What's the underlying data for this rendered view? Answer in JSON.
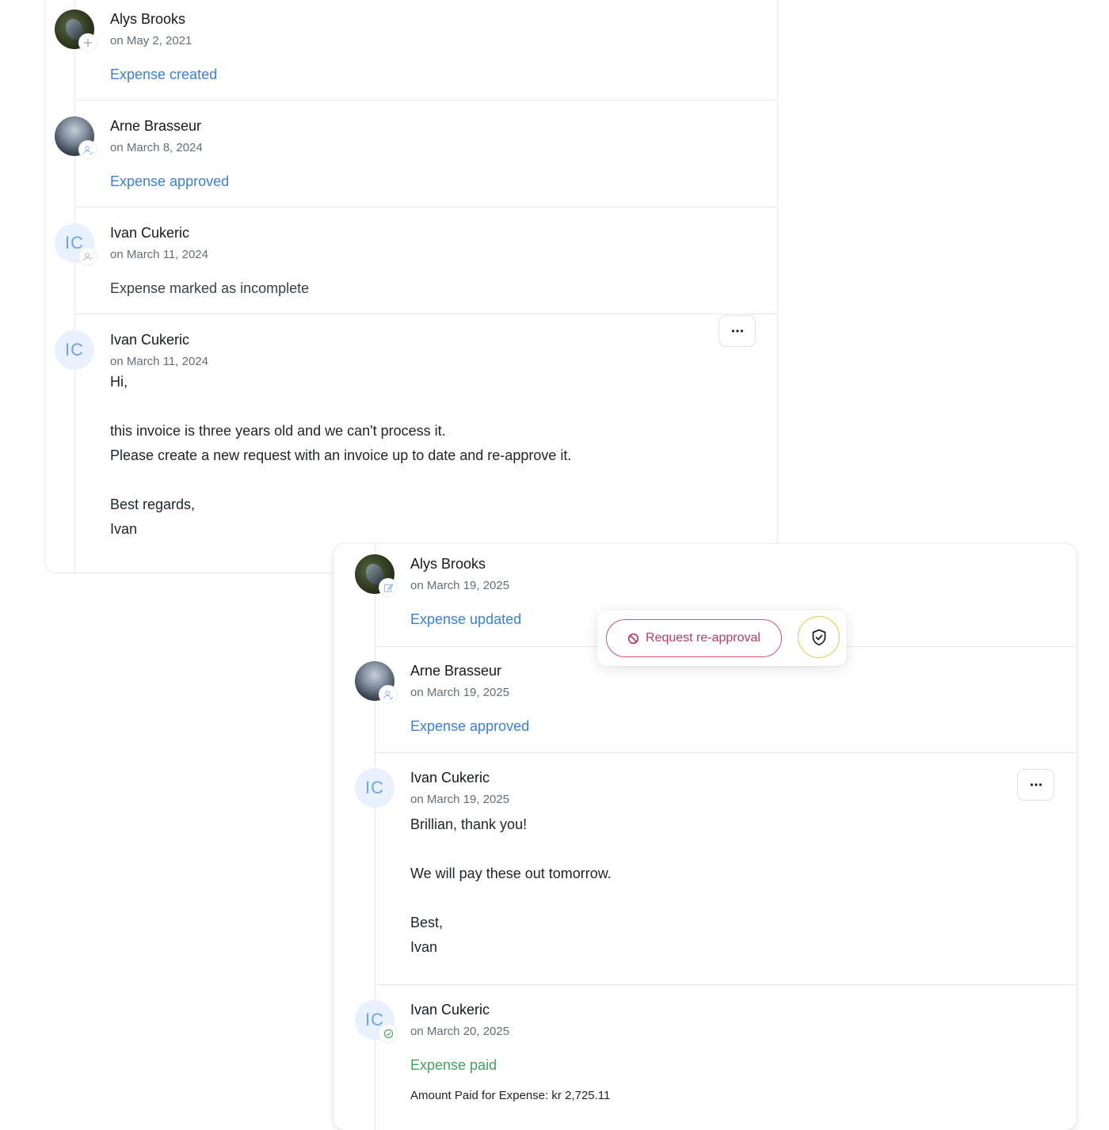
{
  "timeline_back": {
    "entries": [
      {
        "author": "Alys Brooks",
        "date": "on May 2, 2021",
        "action": "Expense created",
        "badge_icon": "plus-icon"
      },
      {
        "author": "Arne Brasseur",
        "date": "on March 8, 2024",
        "action": "Expense approved",
        "badge_icon": "user-check-icon"
      },
      {
        "author": "Ivan Cukeric",
        "initials": "IC",
        "date": "on March 11, 2024",
        "action": "Expense marked as incomplete",
        "badge_icon": "user-icon"
      },
      {
        "author": "Ivan Cukeric",
        "initials": "IC",
        "date": "on March 11, 2024",
        "message": [
          "Hi,",
          "",
          "this invoice is three years old and we can't process it.",
          "Please create a new request with an invoice up to date and re-approve it.",
          "",
          "Best regards,",
          "Ivan"
        ]
      }
    ]
  },
  "timeline_front": {
    "entries": [
      {
        "author": "Alys Brooks",
        "date": "on March 19, 2025",
        "action": "Expense updated",
        "badge_icon": "edit-icon"
      },
      {
        "author": "Arne Brasseur",
        "date": "on March 19, 2025",
        "action": "Expense approved",
        "badge_icon": "user-check-icon"
      },
      {
        "author": "Ivan Cukeric",
        "initials": "IC",
        "date": "on March 19, 2025",
        "message": [
          "Brillian, thank you!",
          "",
          "We will pay these out tomorrow.",
          "",
          "Best,",
          "Ivan"
        ]
      },
      {
        "author": "Ivan Cukeric",
        "initials": "IC",
        "date": "on March 20, 2025",
        "action": "Expense paid",
        "detail": "Amount Paid for Expense: kr 2,725.11",
        "badge_icon": "check-circle-icon"
      }
    ]
  },
  "popover": {
    "reapprove_label": "Request re-approval",
    "reapprove_icon": "ban-icon",
    "shield_icon": "shield-check-icon"
  },
  "colors": {
    "link_blue": "#3a7fe0",
    "paid_green": "#3ea55a",
    "danger": "#c03a60",
    "shield_ring": "#d9cf4a"
  }
}
